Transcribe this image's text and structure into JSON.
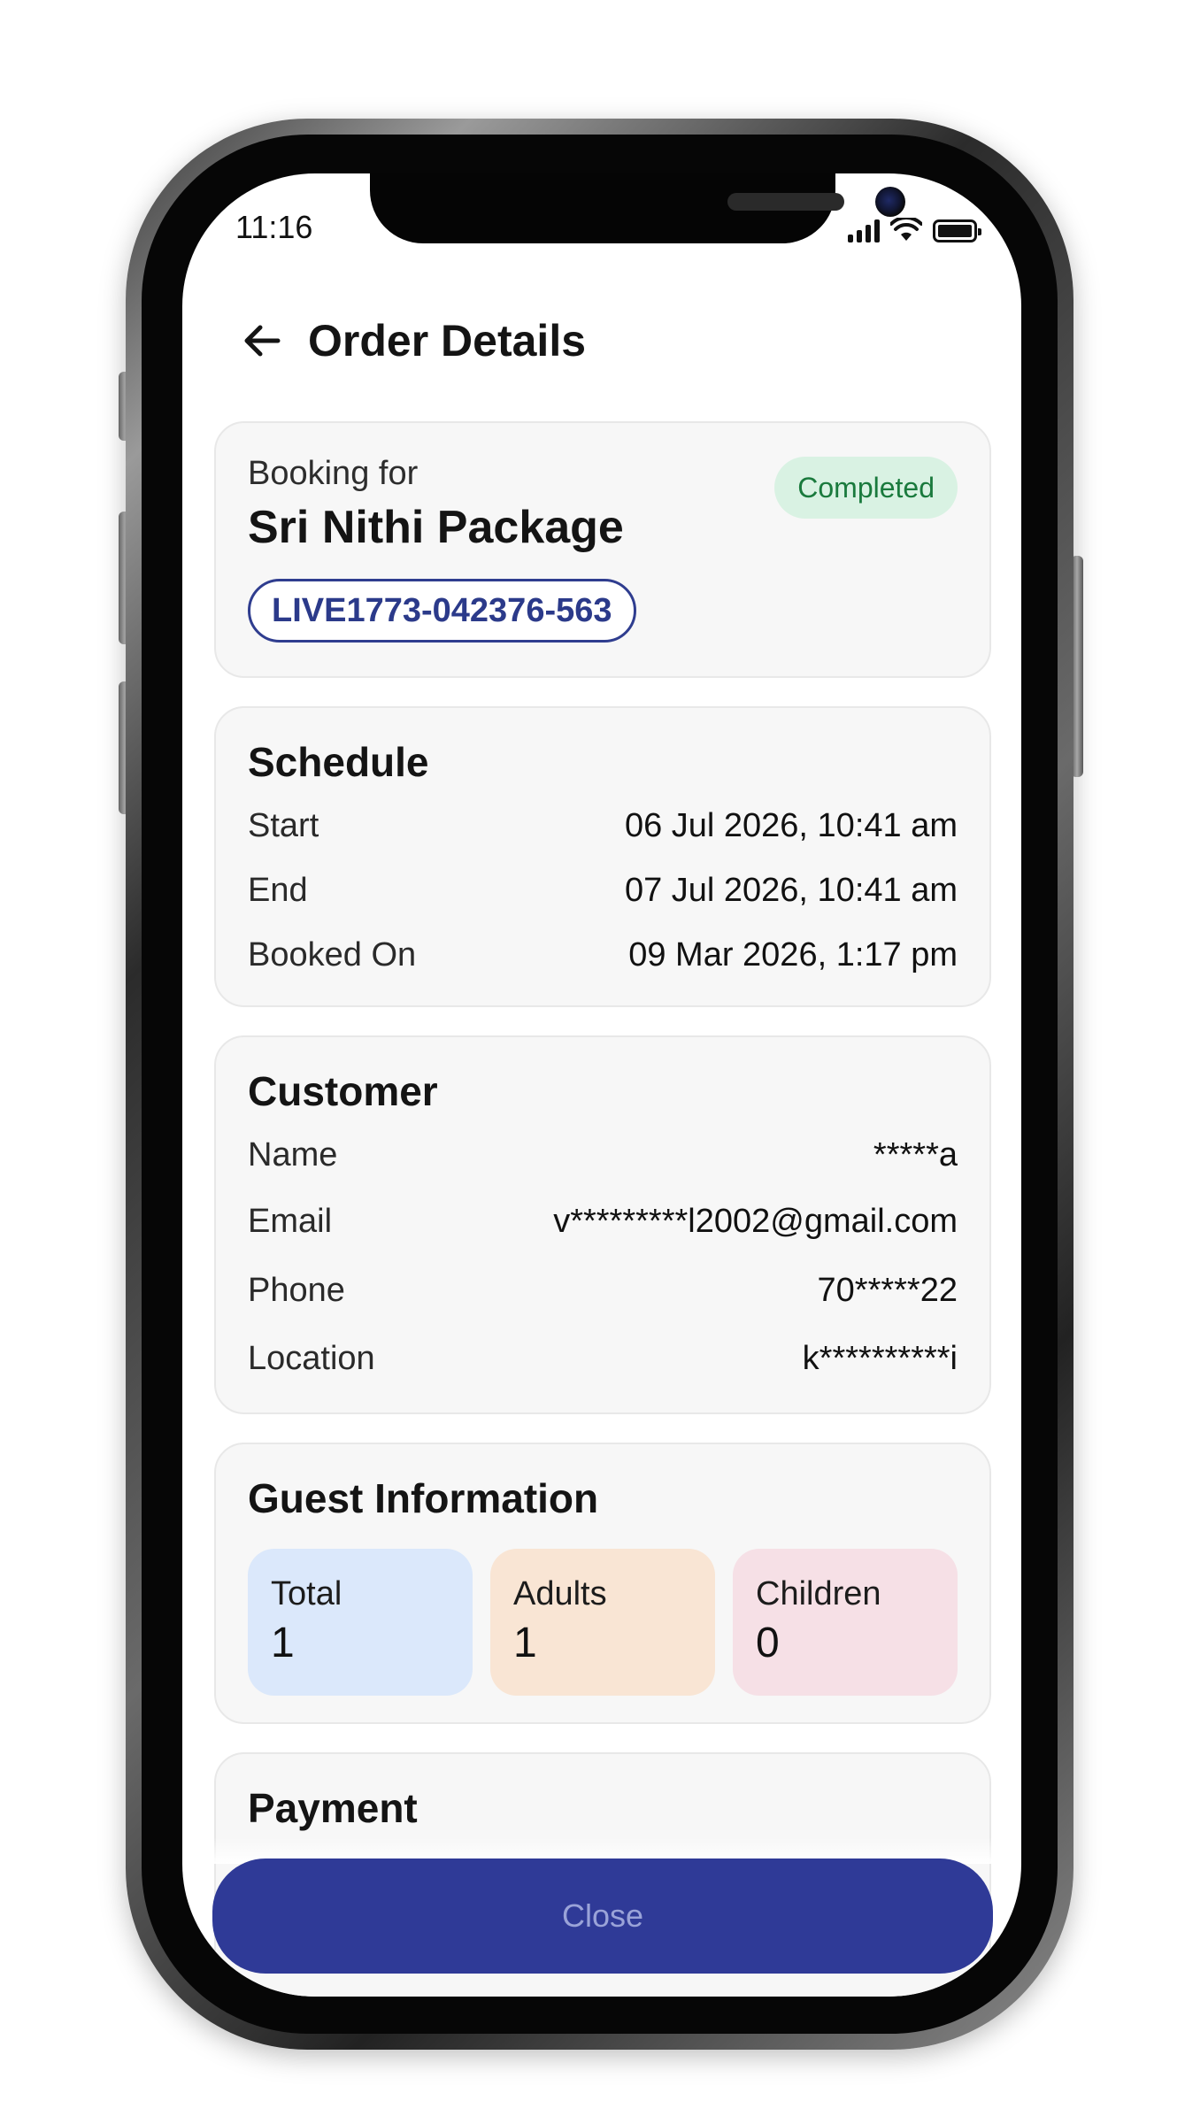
{
  "status_bar": {
    "time": "11:16"
  },
  "header": {
    "title": "Order Details",
    "back_icon": "arrow-left-icon"
  },
  "booking": {
    "label": "Booking for",
    "name": "Sri Nithi Package",
    "status": "Completed",
    "order_id": "LIVE1773-042376-563",
    "status_color": "#1a7a3d"
  },
  "schedule": {
    "title": "Schedule",
    "rows": [
      {
        "label": "Start",
        "value": "06 Jul 2026, 10:41 am"
      },
      {
        "label": "End",
        "value": "07 Jul 2026, 10:41 am"
      },
      {
        "label": "Booked On",
        "value": "09 Mar 2026, 1:17 pm"
      }
    ]
  },
  "customer": {
    "title": "Customer",
    "rows": [
      {
        "label": "Name",
        "value": "*****a"
      },
      {
        "label": "Email",
        "value": "v*********l2002@gmail.com"
      },
      {
        "label": "Phone",
        "value": "70*****22"
      },
      {
        "label": "Location",
        "value": "k**********i"
      }
    ]
  },
  "guests": {
    "title": "Guest Information",
    "tiles": [
      {
        "label": "Total",
        "value": "1"
      },
      {
        "label": "Adults",
        "value": "1"
      },
      {
        "label": "Children",
        "value": "0"
      }
    ]
  },
  "payment": {
    "title": "Payment"
  },
  "footer": {
    "close_label": "Close",
    "accent": "#2f3a97"
  }
}
